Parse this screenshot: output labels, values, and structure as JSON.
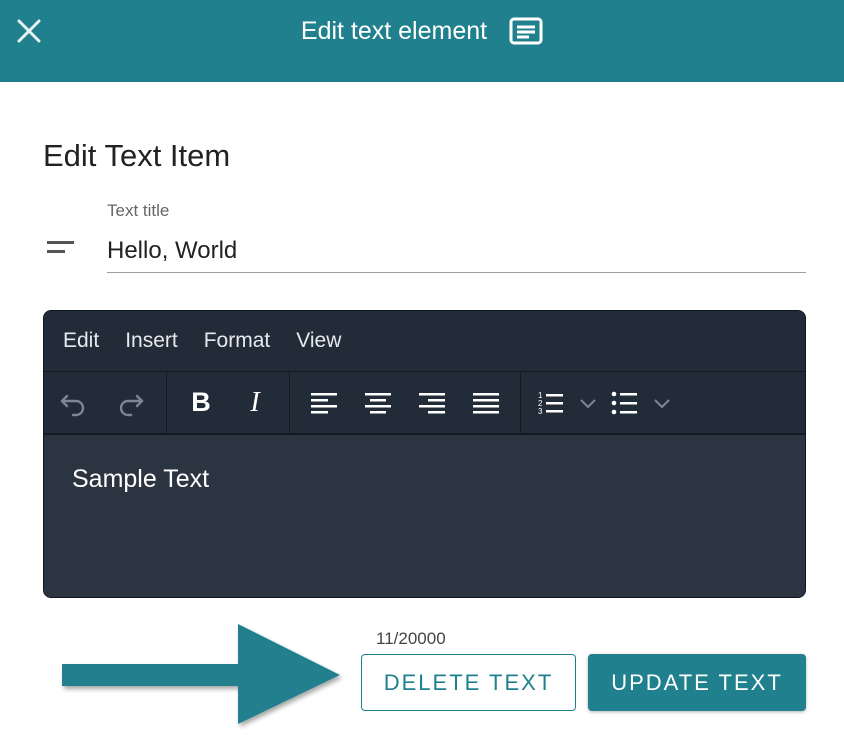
{
  "header": {
    "title": "Edit text element",
    "close_icon": "close-icon",
    "title_icon": "text-snippet-icon",
    "background_color": "#20808e"
  },
  "form": {
    "heading": "Edit Text Item",
    "title_field": {
      "label": "Text title",
      "value": "Hello, World",
      "icon": "short-text-icon"
    }
  },
  "editor": {
    "menu": [
      "Edit",
      "Insert",
      "Format",
      "View"
    ],
    "toolbar": {
      "history": [
        "undo-icon",
        "redo-icon"
      ],
      "formatting": [
        "bold-icon",
        "italic-icon"
      ],
      "alignment": [
        "align-left-icon",
        "align-center-icon",
        "align-right-icon",
        "align-justify-icon"
      ],
      "lists": [
        "numbered-list-icon",
        "bulleted-list-icon"
      ],
      "bold_label": "B",
      "italic_label": "I"
    },
    "content": "Sample Text",
    "background_color": "#2b3441"
  },
  "counter": "11/20000",
  "actions": {
    "delete_label": "DELETE TEXT",
    "update_label": "UPDATE TEXT",
    "accent_color": "#20808e"
  },
  "annotation": {
    "icon": "arrow-right-icon"
  }
}
